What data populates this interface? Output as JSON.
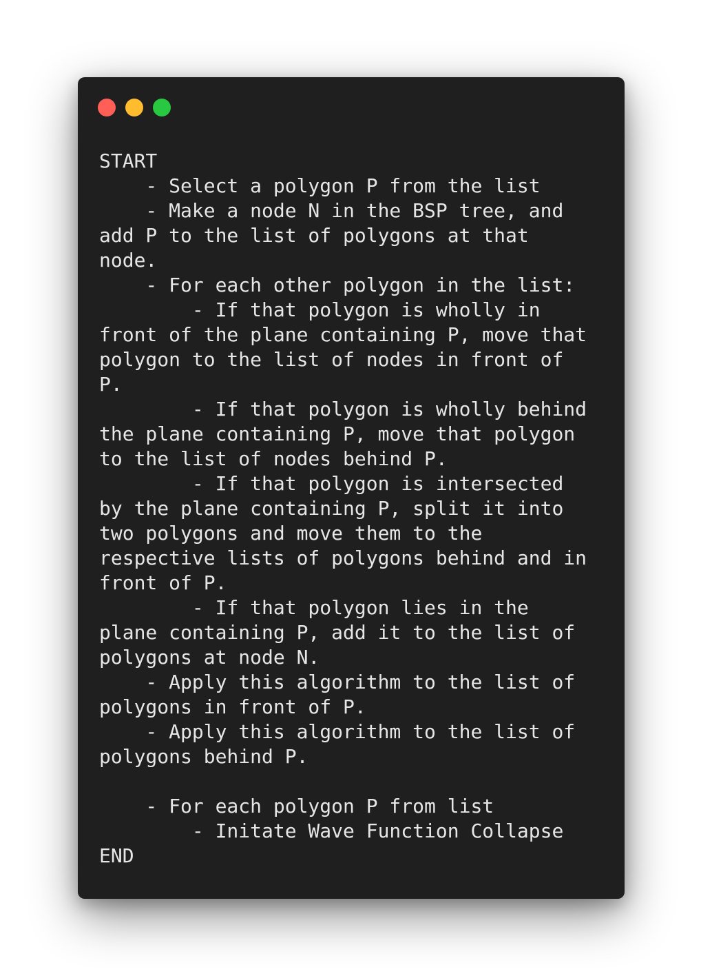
{
  "window": {
    "controls": [
      {
        "name": "close",
        "color": "#ff5f57"
      },
      {
        "name": "minimize",
        "color": "#febc2e"
      },
      {
        "name": "zoom",
        "color": "#28c840"
      }
    ],
    "background": "#1f1f1f",
    "text_color": "#e6e6e6"
  },
  "code": {
    "text": "START\n    - Select a polygon P from the list\n    - Make a node N in the BSP tree, and\nadd P to the list of polygons at that\nnode.\n    - For each other polygon in the list:\n        - If that polygon is wholly in\nfront of the plane containing P, move that\npolygon to the list of nodes in front of\nP.\n        - If that polygon is wholly behind\nthe plane containing P, move that polygon\nto the list of nodes behind P.\n        - If that polygon is intersected\nby the plane containing P, split it into\ntwo polygons and move them to the\nrespective lists of polygons behind and in\nfront of P.\n        - If that polygon lies in the\nplane containing P, add it to the list of\npolygons at node N.\n    - Apply this algorithm to the list of\npolygons in front of P.\n    - Apply this algorithm to the list of\npolygons behind P.\n\n    - For each polygon P from list\n        - Initate Wave Function Collapse\nEND"
  }
}
